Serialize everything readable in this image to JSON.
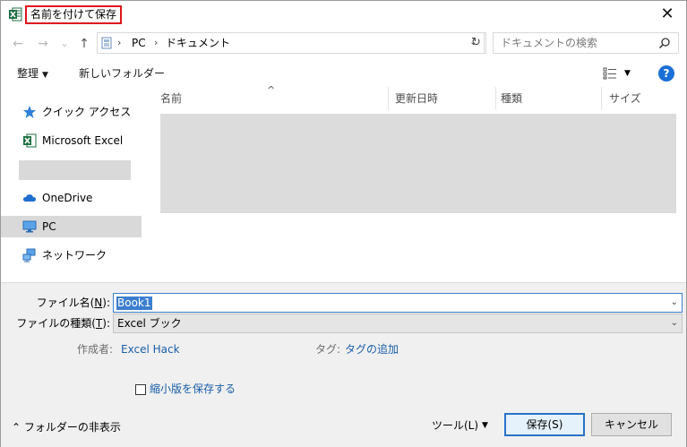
{
  "window": {
    "title": "名前を付けて保存",
    "close_glyph": "✕"
  },
  "nav": {
    "back_glyph": "←",
    "forward_glyph": "→",
    "recent_glyph": "⌄",
    "up_glyph": "↑",
    "breadcrumb": [
      "PC",
      "ドキュメント"
    ],
    "breadcrumb_sep": "›",
    "dropdown_glyph": "⌄",
    "refresh_glyph": "↻",
    "search_placeholder": "ドキュメントの検索"
  },
  "toolbar": {
    "organize_label": "整理",
    "organize_caret": "▼",
    "new_folder_label": "新しいフォルダー",
    "view_caret": "▼",
    "help_label": "?"
  },
  "sidebar": {
    "items": [
      {
        "label": "クイック アクセス",
        "icon": "star-icon"
      },
      {
        "label": "Microsoft Excel",
        "icon": "excel-icon"
      },
      {
        "label": "OneDrive",
        "icon": "cloud-icon"
      },
      {
        "label": "PC",
        "icon": "computer-icon"
      },
      {
        "label": "ネットワーク",
        "icon": "network-icon"
      }
    ]
  },
  "file_list": {
    "sort_glyph": "^",
    "columns": [
      "名前",
      "更新日時",
      "種類",
      "サイズ"
    ]
  },
  "form": {
    "filename_label_prefix": "ファイル名(",
    "filename_label_key": "N",
    "filename_label_suffix": "):",
    "filename_value": "Book1",
    "filetype_label_prefix": "ファイルの種類(",
    "filetype_label_key": "T",
    "filetype_label_suffix": "):",
    "filetype_value": "Excel ブック",
    "dropdown_glyph": "⌄",
    "author_label": "作成者:",
    "author_value": "Excel Hack",
    "tags_label": "タグ:",
    "tags_value": "タグの追加",
    "thumbnail_label": "縮小版を保存する"
  },
  "footer": {
    "hide_folders_glyph": "⌃",
    "hide_folders_label": "フォルダーの非表示",
    "tools_label": "ツール(L)",
    "tools_caret": "▼",
    "save_label": "保存(S)",
    "cancel_label": "キャンセル"
  },
  "colors": {
    "accent": "#2a72c9",
    "title_highlight": "#e0141e",
    "link": "#1a5ea8"
  }
}
